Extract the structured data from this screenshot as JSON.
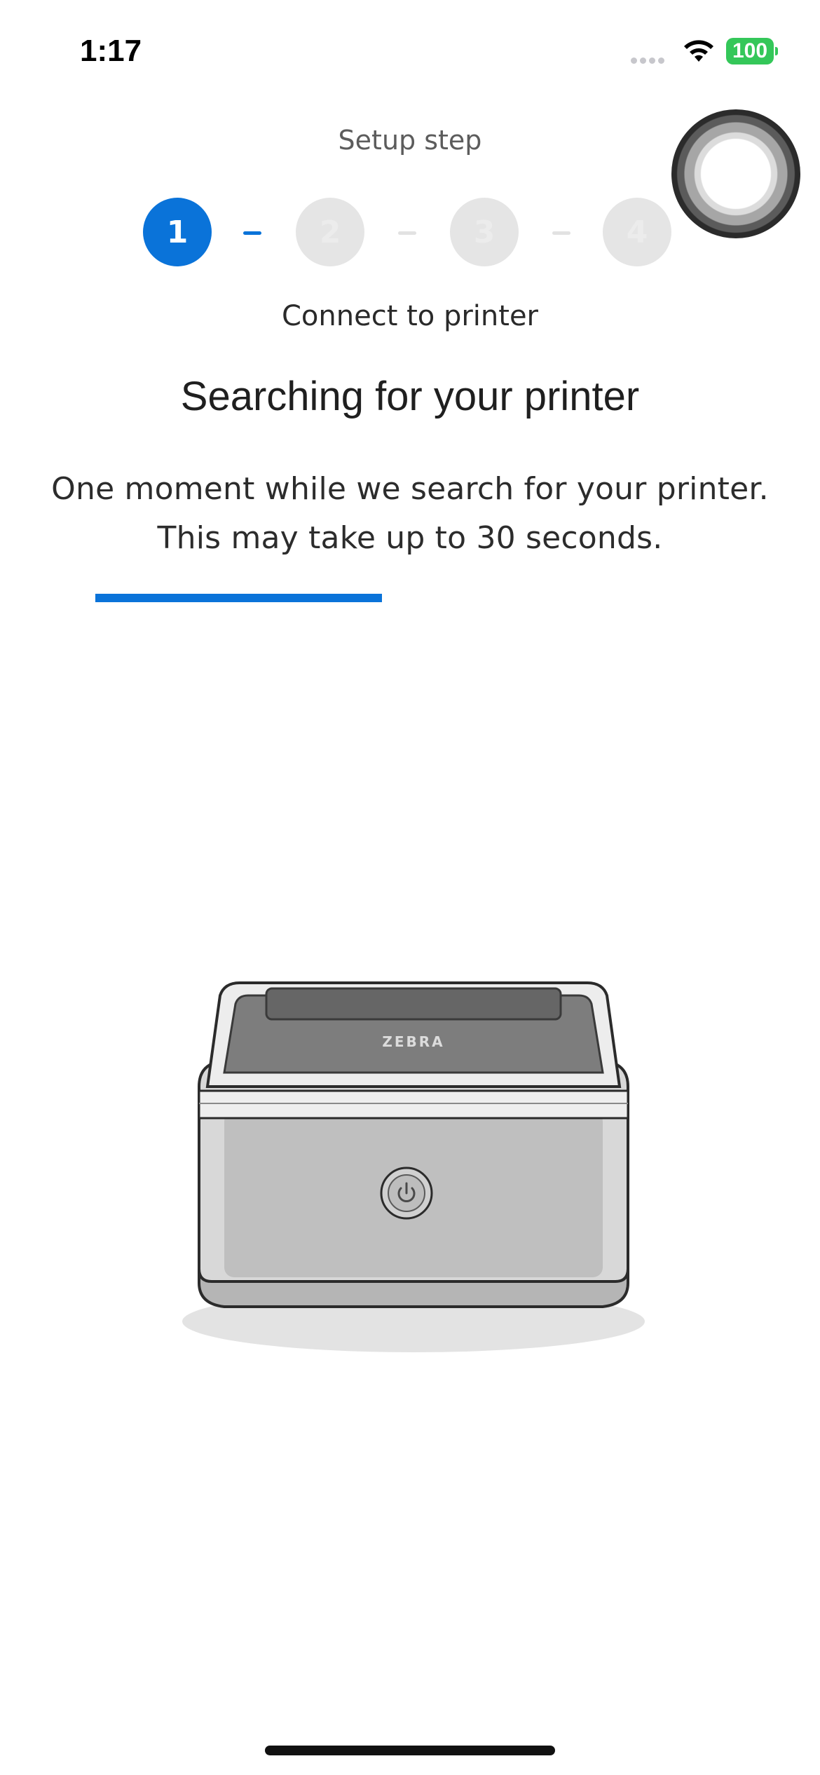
{
  "status_bar": {
    "time": "1:17",
    "battery_level": "100",
    "battery_color": "#34c759"
  },
  "setup": {
    "label": "Setup step",
    "steps": [
      "1",
      "2",
      "3",
      "4"
    ],
    "current_step": 1,
    "current_step_title": "Connect to printer"
  },
  "main": {
    "heading": "Searching for your printer",
    "description_line1": "One moment while we search for your printer.",
    "description_line2": "This may take up to 30 seconds.",
    "progress_fraction": 0.455
  },
  "printer": {
    "brand": "ZEBRA"
  },
  "colors": {
    "accent": "#0a73d9"
  }
}
